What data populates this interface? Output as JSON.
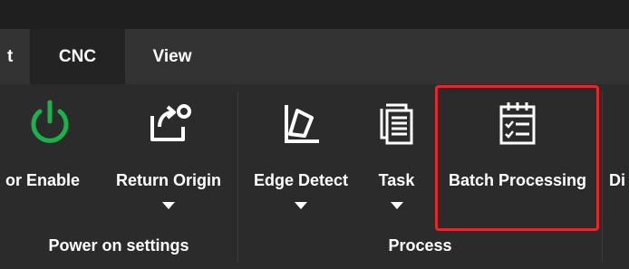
{
  "tabs": [
    {
      "label": "t"
    },
    {
      "label": "CNC",
      "active": true
    },
    {
      "label": "View"
    }
  ],
  "groups": [
    {
      "label": "Power on settings",
      "buttons": [
        {
          "label": "or Enable",
          "icon": "power-icon",
          "dropdown": false
        },
        {
          "label": "Return Origin",
          "icon": "return-origin-icon",
          "dropdown": true
        }
      ]
    },
    {
      "label": "Process",
      "buttons": [
        {
          "label": "Edge Detect",
          "icon": "edge-detect-icon",
          "dropdown": true
        },
        {
          "label": "Task",
          "icon": "task-icon",
          "dropdown": true
        },
        {
          "label": "Batch Processing",
          "icon": "batch-processing-icon",
          "dropdown": false,
          "highlighted": true
        }
      ]
    },
    {
      "label": "",
      "buttons": [
        {
          "label": "Di",
          "icon": "",
          "dropdown": false
        }
      ]
    }
  ],
  "colors": {
    "power_icon": "#1db14b",
    "highlight_border": "#e3272d",
    "active_tab_bg": "#232323",
    "tabbar_bg": "#333333",
    "ribbon_bg": "#2b2b2b"
  }
}
